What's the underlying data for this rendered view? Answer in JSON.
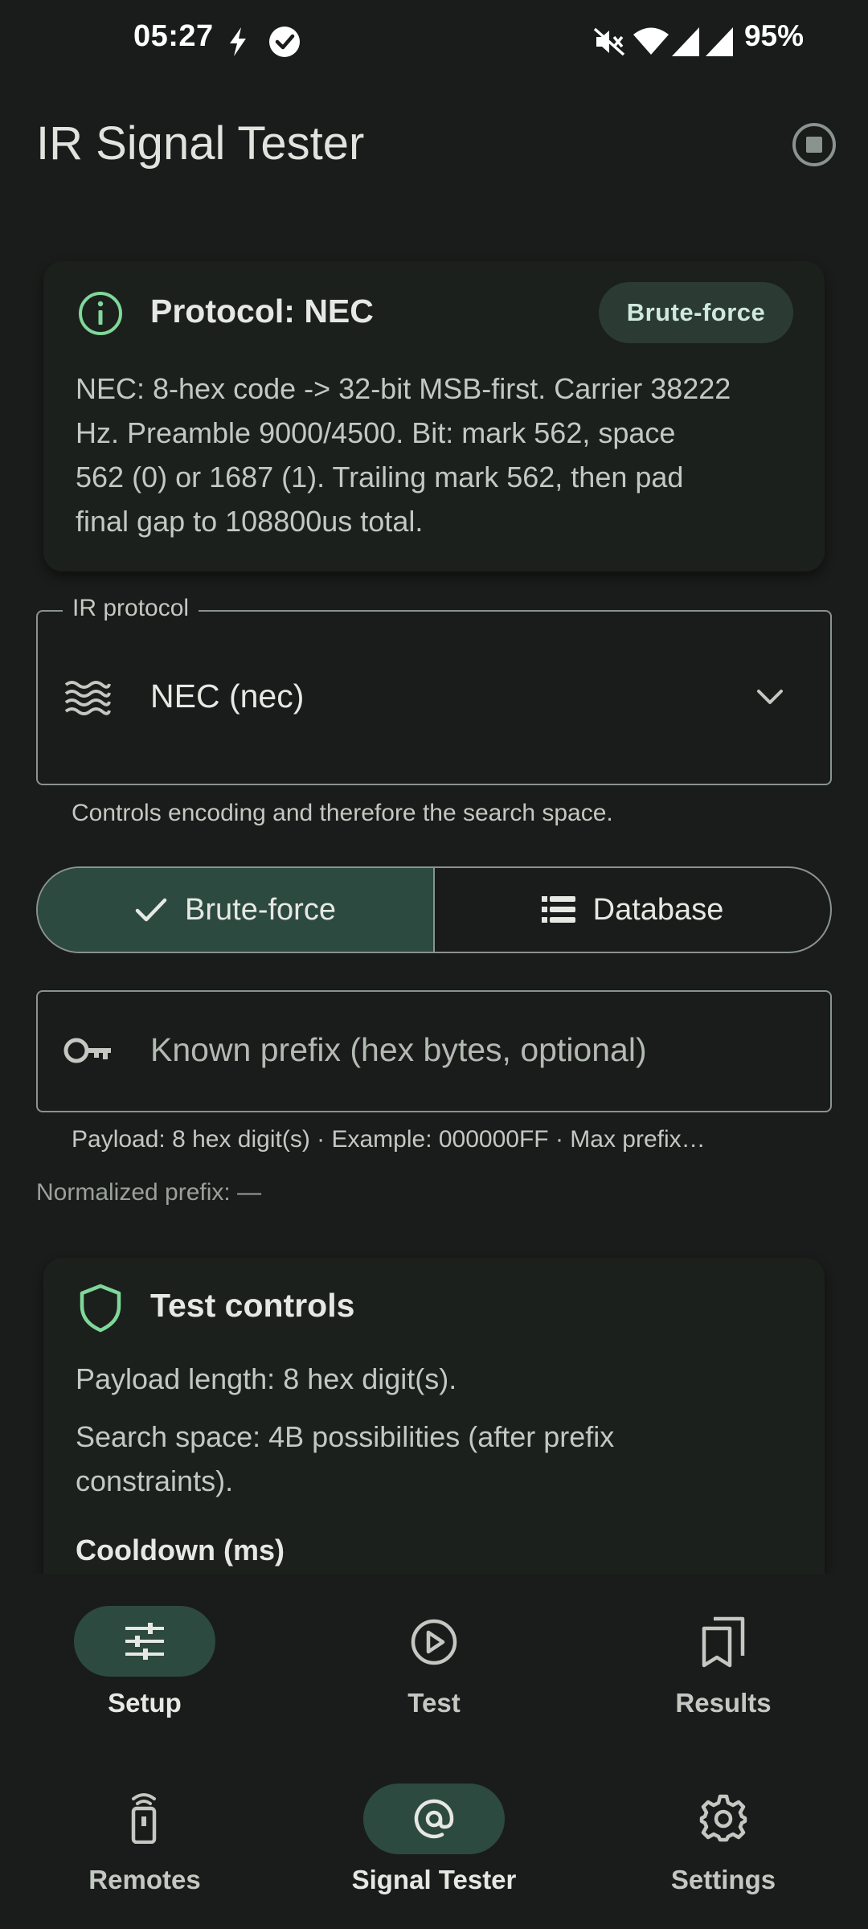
{
  "status": {
    "time": "05:27",
    "battery": "95%"
  },
  "app": {
    "title": "IR Signal Tester"
  },
  "protocol_card": {
    "title": "Protocol: NEC",
    "badge": "Brute-force",
    "lines": [
      "NEC: 8-hex code -> 32-bit MSB-first. Carrier 38222",
      "Hz. Preamble 9000/4500. Bit: mark 562, space",
      "562 (0) or 1687 (1). Trailing mark 562, then pad",
      "final gap to 108800us total."
    ]
  },
  "protocol_field": {
    "label": "IR protocol",
    "value": "NEC (nec)",
    "helper": "Controls encoding and therefore the search space."
  },
  "mode": {
    "brute_force": "Brute-force",
    "database": "Database",
    "selected": "Brute-force"
  },
  "prefix_field": {
    "placeholder": "Known prefix (hex bytes, optional)",
    "helper": "Payload: 8 hex digit(s) · Example: 000000FF · Max prefix…",
    "normalized": "Normalized prefix: —"
  },
  "test_controls": {
    "title": "Test controls",
    "payload_length": "Payload length: 8 hex digit(s).",
    "search_space_lines": [
      "Search space: 4B possibilities (after prefix",
      "constraints)."
    ],
    "cooldown_label": "Cooldown (ms)"
  },
  "sub_nav": {
    "items": [
      {
        "label": "Setup",
        "icon": "tune-icon",
        "active": true
      },
      {
        "label": "Test",
        "icon": "play-circle-icon",
        "active": false
      },
      {
        "label": "Results",
        "icon": "bookmarks-icon",
        "active": false
      }
    ]
  },
  "main_nav": {
    "items": [
      {
        "label": "Remotes",
        "icon": "remote-icon",
        "active": false
      },
      {
        "label": "Signal Tester",
        "icon": "radar-icon",
        "active": true
      },
      {
        "label": "Settings",
        "icon": "gear-icon",
        "active": false
      }
    ]
  }
}
